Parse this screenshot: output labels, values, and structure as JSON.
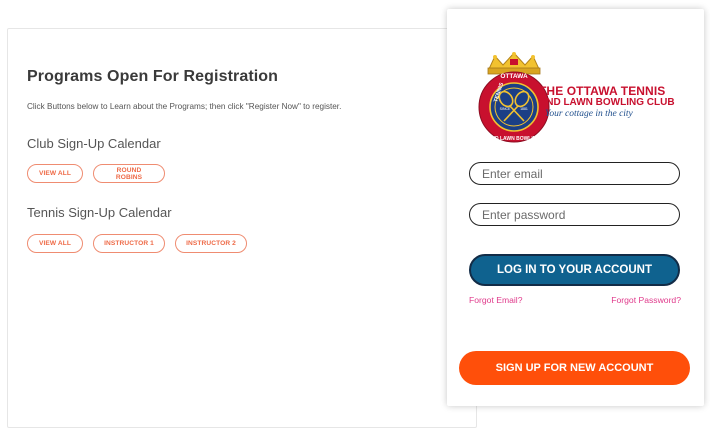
{
  "programs": {
    "title": "Programs Open For Registration",
    "description": "Click Buttons below to Learn about the Programs; then click \"Register Now\" to register.",
    "club_calendar": {
      "title": "Club Sign-Up Calendar",
      "buttons": [
        "VIEW ALL",
        "ROUND ROBINS"
      ]
    },
    "tennis_calendar": {
      "title": "Tennis Sign-Up Calendar",
      "buttons": [
        "VIEW ALL",
        "INSTRUCTOR 1",
        "INSTRUCTOR 2"
      ]
    },
    "button_color": "#ee6a47"
  },
  "login": {
    "club_name_line1": "THE OTTAWA TENNIS",
    "club_name_line2": "AND LAWN BOWLING CLUB",
    "tagline": "Your cottage in the city",
    "logo_icon": "crown-crest-logo",
    "logo_text_top": "OTTAWA",
    "logo_text_left": "TENNIS",
    "logo_text_bottom": "AND LAWN BOWLING",
    "logo_since": "SINCE",
    "logo_year": "1881",
    "email_placeholder": "Enter email",
    "password_placeholder": "Enter password",
    "login_label": "LOG IN TO YOUR ACCOUNT",
    "forgot_email": "Forgot Email?",
    "forgot_password": "Forgot Password?",
    "signup_label": "SIGN UP FOR NEW ACCOUNT",
    "colors": {
      "login_button": "#0f628f",
      "signup_button": "#ff4f0a",
      "forgot_links": "#e03a8b",
      "club_name": "#c8102e",
      "tagline": "#1f4e8c"
    }
  }
}
